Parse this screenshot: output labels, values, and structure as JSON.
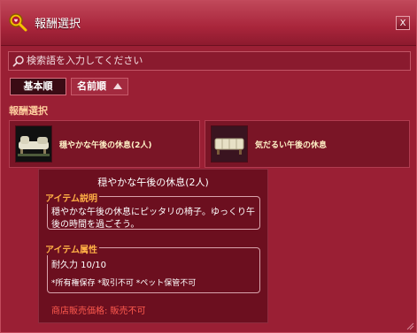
{
  "window": {
    "title": "報酬選択",
    "close_label": "X"
  },
  "search": {
    "placeholder": "検索語を入力してください"
  },
  "sort": {
    "basic_label": "基本順",
    "name_label": "名前順"
  },
  "rewards": {
    "section_label": "報酬選択",
    "items": [
      {
        "label": "穏やかな午後の休息(2人)"
      },
      {
        "label": "気だるい午後の休息"
      }
    ]
  },
  "tooltip": {
    "title": "穏やかな午後の休息(2人)",
    "description_heading": "アイテム説明",
    "description": "穏やかな午後の休息にピッタリの椅子。ゆっくり午後の時間を過ごそう。",
    "attributes_heading": "アイテム属性",
    "durability": "耐久力 10/10",
    "flags": "*所有権保存 *取引不可 *ペット保管不可",
    "price": "商店販売価格: 販売不可"
  },
  "colors": {
    "window_bg": "#9a1f34",
    "tooltip_bg": "#6c0f1f",
    "heading_orange": "#ffb046",
    "price_red": "#ff5a4e",
    "section_label": "#ffcf9e"
  }
}
